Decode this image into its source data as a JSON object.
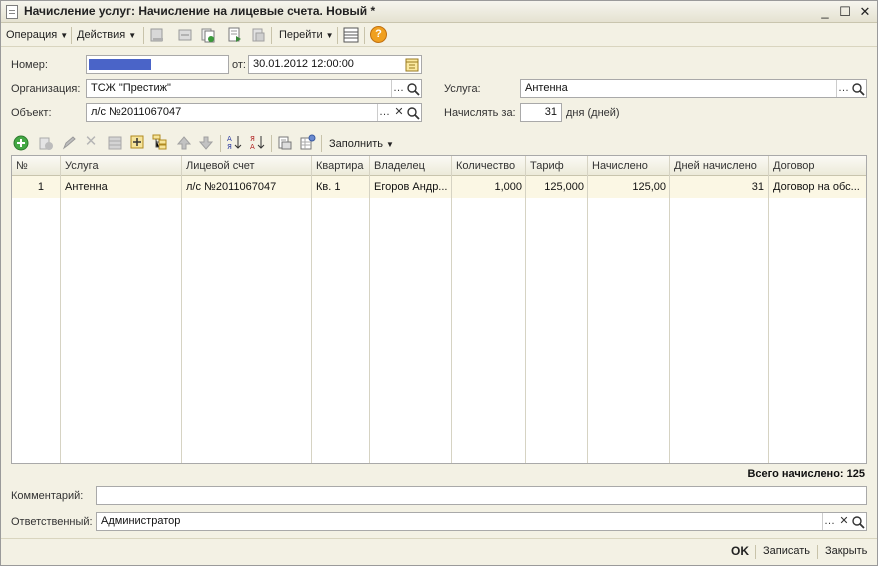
{
  "window": {
    "title": "Начисление услуг: Начисление на лицевые счета. Новый *",
    "controls": [
      "_",
      "☐",
      "✕"
    ]
  },
  "toolbar": {
    "operation_label": "Операция",
    "actions_label": "Действия",
    "goto_label": "Перейти",
    "help_glyph": "?"
  },
  "form": {
    "number_label": "Номер:",
    "date_label": "от:",
    "date_value": "30.01.2012 12:00:00",
    "org_label": "Организация:",
    "org_value": "ТСЖ \"Престиж\"",
    "object_label": "Объект:",
    "object_value": "л/с №2011067047",
    "service_label": "Услуга:",
    "service_value": "Антенна",
    "charge_for_label": "Начислять за:",
    "charge_for_value": "31",
    "days_label": "дня (дней)",
    "fill_label": "Заполнить"
  },
  "table": {
    "columns": [
      "№",
      "Услуга",
      "Лицевой счет",
      "Квартира",
      "Владелец",
      "Количество",
      "Тариф",
      "Начислено",
      "Дней начислено",
      "Договор"
    ],
    "rows": [
      [
        "1",
        "Антенна",
        "л/с №2011067047",
        "Кв. 1",
        "Егоров Андр...",
        "1,000",
        "125,000",
        "125,00",
        "31",
        "Договор на обс..."
      ]
    ]
  },
  "total": "Всего начислено: 125",
  "comment_label": "Комментарий:",
  "comment_value": "",
  "responsible_label": "Ответственный:",
  "responsible_value": "Администратор",
  "footer": {
    "ok": "OK",
    "save": "Записать",
    "close": "Закрыть"
  },
  "colors": {
    "accent_number_field": "#4a64c8",
    "row_highlight": "#fbf7e4"
  }
}
